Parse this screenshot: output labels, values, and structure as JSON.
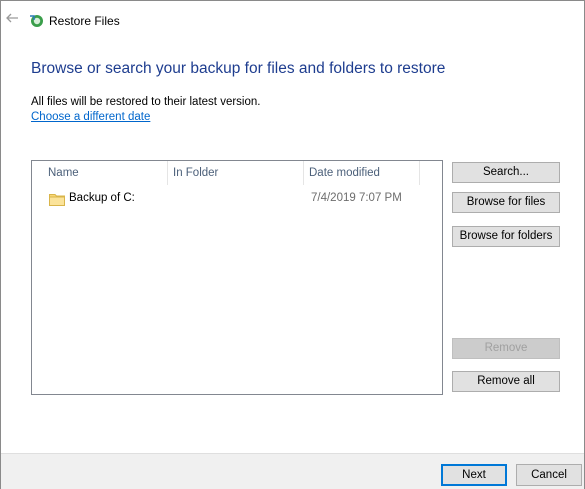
{
  "window": {
    "title": "Restore Files"
  },
  "page": {
    "heading": "Browse or search your backup for files and folders to restore",
    "info": "All files will be restored to their latest version.",
    "date_link": "Choose a different date"
  },
  "list": {
    "columns": [
      "Name",
      "In Folder",
      "Date modified"
    ],
    "rows": [
      {
        "name": "Backup of C:",
        "folder": "",
        "date": "7/4/2019 7:07 PM",
        "icon": "folder-icon"
      }
    ]
  },
  "side_buttons": {
    "search": "Search...",
    "browse_files": "Browse for files",
    "browse_folders": "Browse for folders",
    "remove": "Remove",
    "remove_all": "Remove all"
  },
  "footer": {
    "next": "Next",
    "cancel": "Cancel"
  },
  "colors": {
    "heading": "#1e3d8f",
    "link": "#0066cc",
    "folder": "#f8d775",
    "accent": "#0078d7"
  }
}
